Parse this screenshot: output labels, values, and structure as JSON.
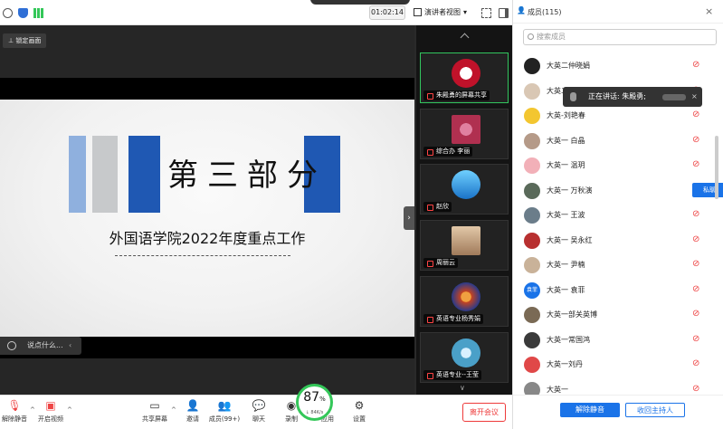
{
  "topbar": {
    "sharing_title": "",
    "timer": "01:02:14",
    "view_label": "演讲者视图"
  },
  "stage": {
    "lock_label": "锁定画面",
    "slide_title": "第三部分",
    "slide_subtitle": "外国语学院2022年度重点工作",
    "chat_placeholder": "说点什么..."
  },
  "gallery": {
    "thumbs": [
      {
        "name": "朱殿勇的屏幕共享",
        "color": "#c0122a"
      },
      {
        "name": "综合办 李丽",
        "color": "#b03050"
      },
      {
        "name": "赵欣",
        "color": "#2a8bd4"
      },
      {
        "name": "周丽云",
        "color": "#c9a27a"
      },
      {
        "name": "英语专业杨秀娟",
        "color": "#c8441f"
      },
      {
        "name": "英语专业--王莹",
        "color": "#4aa0c8"
      }
    ]
  },
  "toolbar": {
    "unmute": "解除静音",
    "start_video": "开启视频",
    "share": "共享屏幕",
    "invite": "邀请",
    "members": "成员(99+)",
    "chat": "聊天",
    "record": "录制",
    "apps": "应用",
    "settings": "设置",
    "end": "离开会议",
    "speed_percent": "87",
    "speed_unit": "%",
    "speed_rate": "↓ 84K/s"
  },
  "panel": {
    "title": "成员(115)",
    "search_placeholder": "搜索成员",
    "speaking_label": "正在讲话: 朱殿勇;",
    "dm_label": "私聊",
    "members": [
      {
        "name": "大英二仲晓娟",
        "color": "#222"
      },
      {
        "name": "大英二",
        "color": "#d9c7b4"
      },
      {
        "name": "大英-刘艳春",
        "color": "#f3c630"
      },
      {
        "name": "大英一 白晶",
        "color": "#b59a88"
      },
      {
        "name": "大英一 温玥",
        "color": "#f2b0b8"
      },
      {
        "name": "大英一 万秋演",
        "color": "#5a6a5a"
      },
      {
        "name": "大英一 王波",
        "color": "#6b7d8a"
      },
      {
        "name": "大英一 吴永红",
        "color": "#b83030"
      },
      {
        "name": "大英一 尹楠",
        "color": "#c9b299"
      },
      {
        "name": "大英一 袁菲",
        "color": "#1a73e8",
        "avatar_text": "袁菲"
      },
      {
        "name": "大英一部关英博",
        "color": "#7a6a55"
      },
      {
        "name": "大英一常国鸿",
        "color": "#3a3a3a"
      },
      {
        "name": "大英一刘丹",
        "color": "#e04848"
      },
      {
        "name": "大英一",
        "color": "#888"
      }
    ],
    "mute_all": "解除静音",
    "reclaim_host": "收回主持人"
  }
}
